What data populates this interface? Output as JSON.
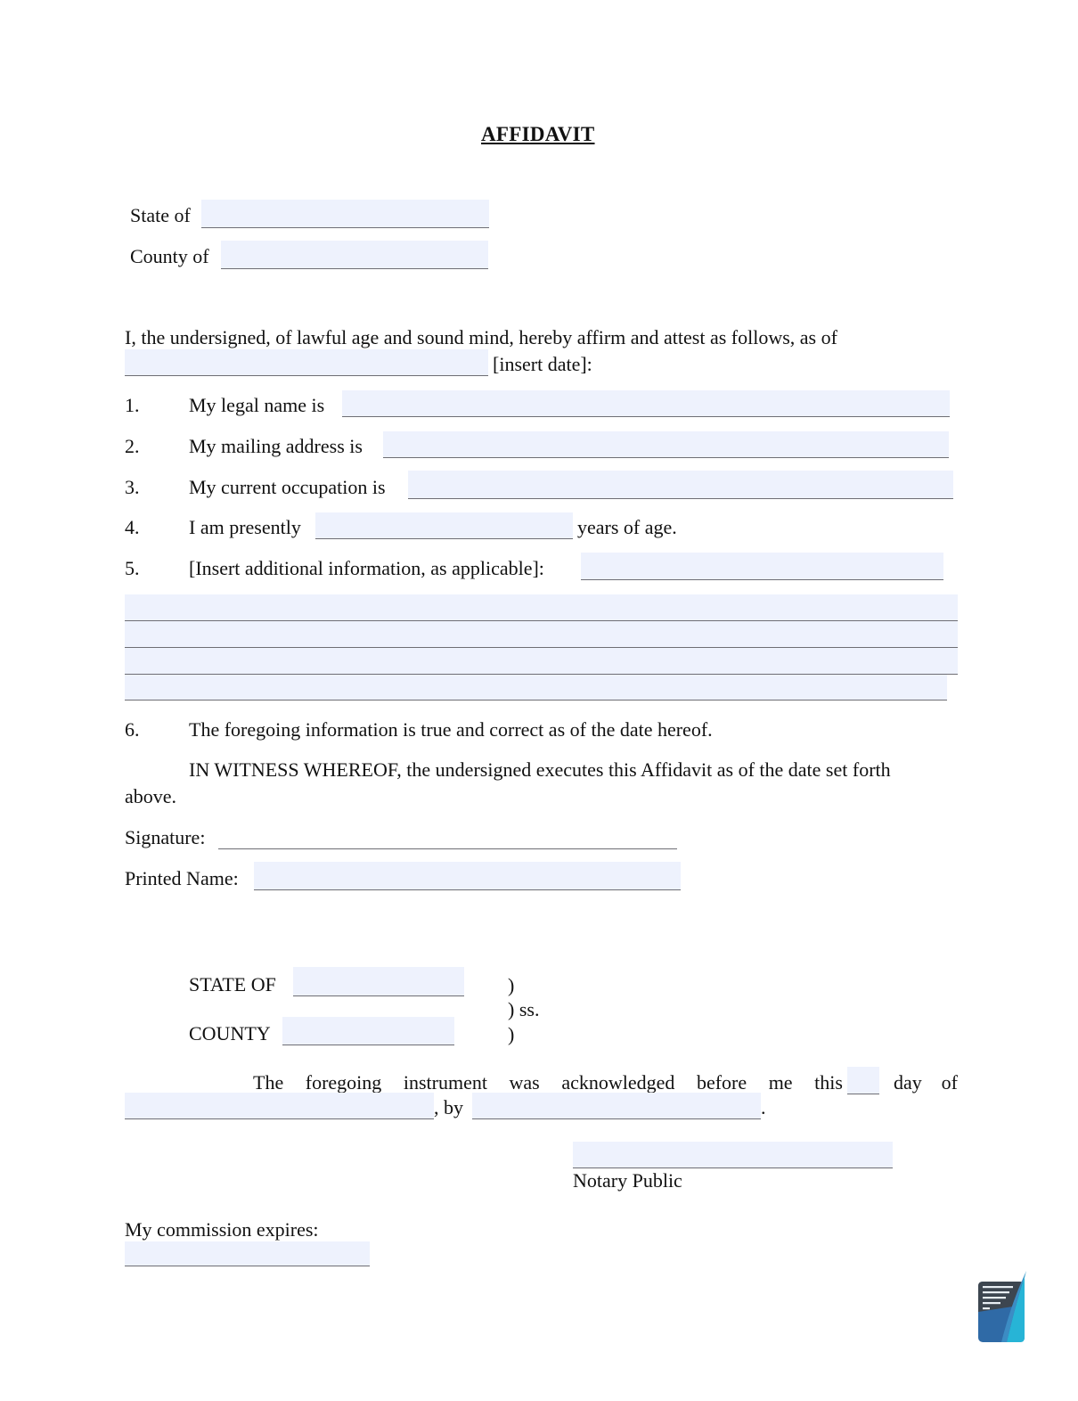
{
  "document": {
    "title": "AFFIDAVIT",
    "venue": {
      "state_label": "State of",
      "state_value": "",
      "county_label": "County of",
      "county_value": ""
    },
    "intro": {
      "text": "I, the undersigned, of lawful age and sound mind, hereby affirm and attest as follows, as of",
      "date_value": "",
      "date_hint": "[insert date]:"
    },
    "items": [
      {
        "number": "1.",
        "label": "My legal name is",
        "value": ""
      },
      {
        "number": "2.",
        "label": "My mailing address is",
        "value": ""
      },
      {
        "number": "3.",
        "label": "My current occupation is",
        "value": ""
      },
      {
        "number": "4.",
        "label": "I am presently",
        "value": "",
        "suffix": "years of age."
      },
      {
        "number": "5.",
        "label": "[Insert additional information, as applicable]:",
        "value": ""
      },
      {
        "number": "6.",
        "label": "The foregoing information is true and correct as of the date hereof."
      }
    ],
    "additional_lines": [
      "",
      "",
      "",
      ""
    ],
    "witness": {
      "line1": "IN WITNESS WHEREOF, the undersigned executes this Affidavit as of the date set forth",
      "line2": "above."
    },
    "signature_label": "Signature:",
    "printed_name_label": "Printed Name:",
    "printed_name_value": "",
    "notary": {
      "state_label": "STATE OF",
      "state_value": "",
      "county_label": "COUNTY",
      "county_value": "",
      "paren1": ")",
      "paren2": ") ss.",
      "paren3": ")",
      "ack_words": [
        "The",
        "foregoing",
        "instrument",
        "was",
        "acknowledged",
        "before",
        "me",
        "this"
      ],
      "day_value": "",
      "ack_tail": [
        "day",
        "of"
      ],
      "by_label": ", by",
      "period": ".",
      "notary_public_label": "Notary Public",
      "commission_label": "My commission expires:",
      "commission_value": ""
    }
  },
  "colors": {
    "field_fill": "#eef2fd",
    "underline": "#6e6e74",
    "logo_dark": "#3d4650",
    "logo_blue": "#2f6aa6",
    "logo_teal": "#27b4d6"
  },
  "logo": {
    "icon": "document-feather-logo"
  }
}
